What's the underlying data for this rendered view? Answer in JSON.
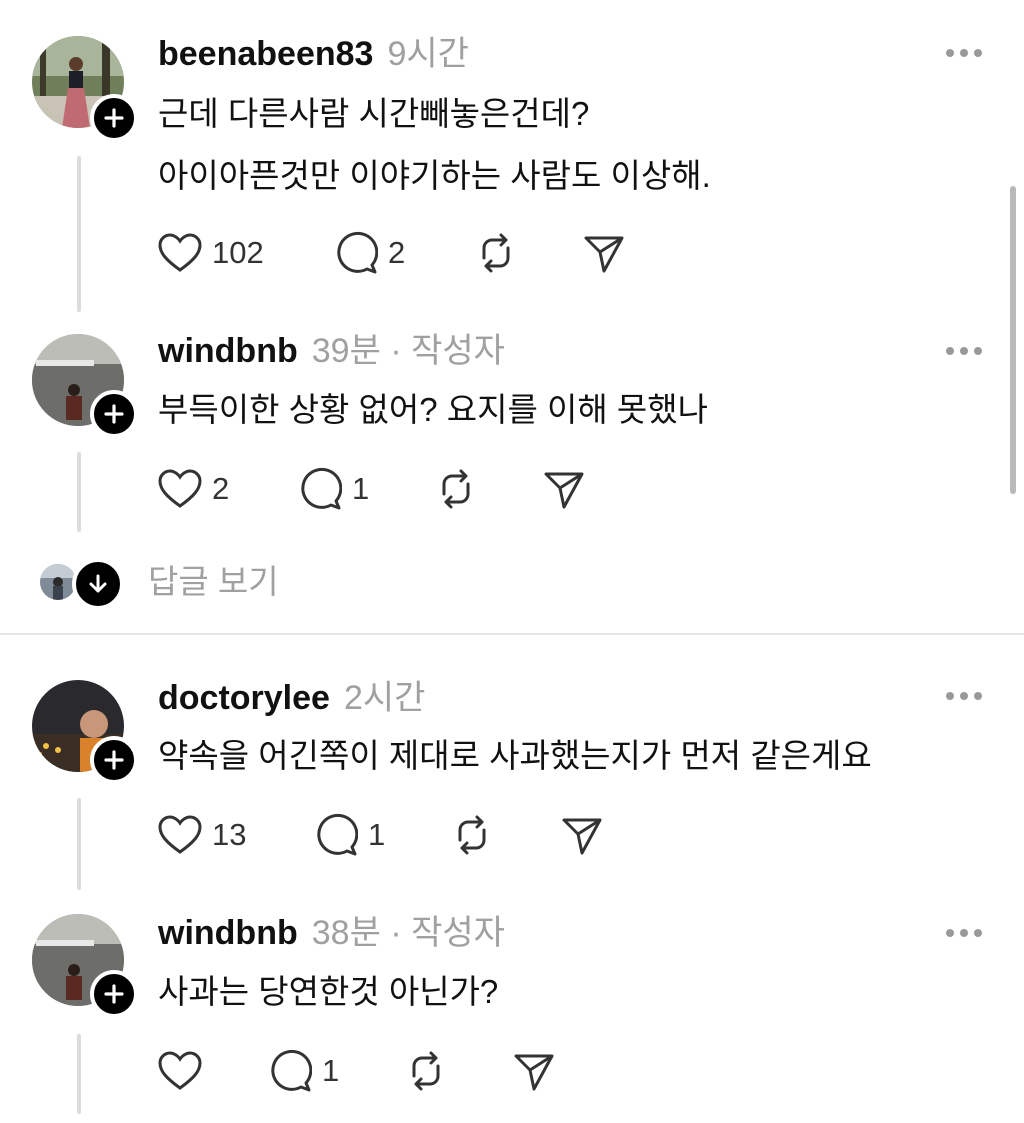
{
  "posts": [
    {
      "username": "beenabeen83",
      "time": "9시간",
      "author_tag": "",
      "lines": [
        "근데 다른사람 시간빼놓은건데?",
        "아이아픈것만 이야기하는 사람도 이상해."
      ],
      "likes": "102",
      "replies": "2"
    },
    {
      "username": "windbnb",
      "time": "39분",
      "author_tag": "· 작성자",
      "lines": [
        "부득이한 상황 없어? 요지를 이해 못했나"
      ],
      "likes": "2",
      "replies": "1"
    },
    {
      "username": "doctorylee",
      "time": "2시간",
      "author_tag": "",
      "lines": [
        "약속을 어긴쪽이 제대로 사과했는지가 먼저 같은게요"
      ],
      "likes": "13",
      "replies": "1"
    },
    {
      "username": "windbnb",
      "time": "38분",
      "author_tag": "· 작성자",
      "lines": [
        "사과는 당연한것 아닌가?"
      ],
      "likes": "",
      "replies": "1"
    }
  ],
  "view_replies_label": "답글 보기",
  "icons": {
    "like": "heart-icon",
    "reply": "comment-icon",
    "repost": "repost-icon",
    "share": "send-icon",
    "more": "more-dots-icon",
    "follow": "plus-icon",
    "expand": "arrow-down-icon"
  }
}
